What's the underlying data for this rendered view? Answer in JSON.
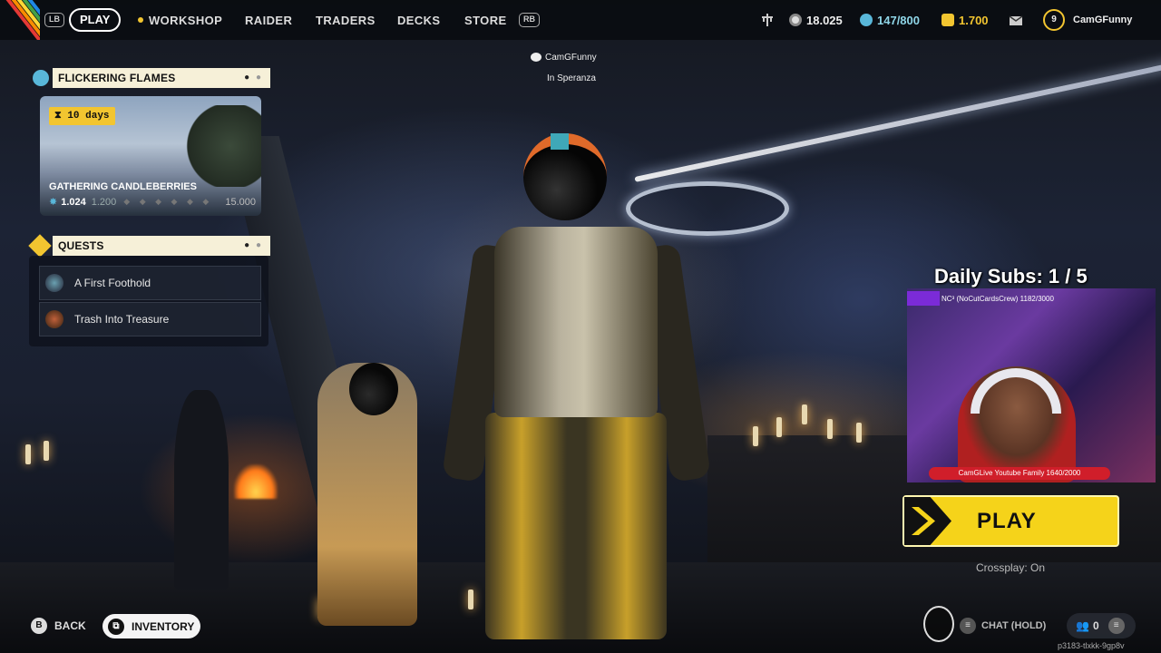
{
  "topbar": {
    "lb": "LB",
    "rb": "RB",
    "play": "PLAY",
    "nav": [
      "WORKSHOP",
      "RAIDER",
      "TRADERS",
      "DECKS",
      "STORE"
    ],
    "coins": "18.025",
    "stash": "147/800",
    "tokens": "1.700",
    "level": "9",
    "username": "CamGFunny"
  },
  "event": {
    "title": "FLICKERING FLAMES",
    "days": "10 days",
    "card_title": "GATHERING CANDLEBERRIES",
    "current": "1.024",
    "next": "1.200",
    "diamonds": "◆ ◆ ◆ ◆ ◆ ◆",
    "max": "15.000"
  },
  "quests": {
    "title": "QUESTS",
    "items": [
      "A First Foothold",
      "Trash Into Treasure"
    ]
  },
  "player": {
    "name": "CamGFunny",
    "location": "In Speranza"
  },
  "stream": {
    "daily_subs": "Daily Subs: 1 / 5",
    "cam_top": "NC³ (NoCutCardsCrew) 1182/3000",
    "cam_bottom": "CamGLive Youtube Family 1640/2000"
  },
  "play_button": {
    "label": "PLAY",
    "crossplay": "Crossplay: On"
  },
  "bottom": {
    "b_key": "B",
    "back": "BACK",
    "inventory": "INVENTORY",
    "chat": "CHAT (HOLD)",
    "party_count": "0",
    "session": "p3183-tlxkk-9gp8v"
  },
  "colors": {
    "accent": "#f2c530",
    "play_button": "#f5d31a",
    "event_icon": "#59b7d9",
    "panel_header": "#f6f0d8"
  }
}
